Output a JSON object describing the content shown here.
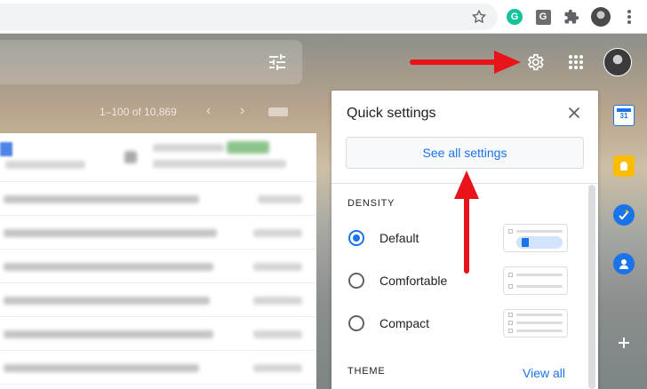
{
  "browser": {
    "icons": [
      "star-icon",
      "grammarly-icon",
      "g-extension-icon",
      "extensions-puzzle-icon",
      "profile-avatar",
      "more-vert-icon"
    ],
    "grammarly_color": "#15c39a"
  },
  "gmail": {
    "pager": "1–100 of 10,869",
    "accent": "#1a73e8"
  },
  "quick_settings": {
    "title": "Quick settings",
    "see_all": "See all settings",
    "density_heading": "DENSITY",
    "options": [
      {
        "label": "Default",
        "checked": true
      },
      {
        "label": "Comfortable",
        "checked": false
      },
      {
        "label": "Compact",
        "checked": false
      }
    ],
    "theme_heading": "THEME",
    "view_all": "View all"
  },
  "side_apps": [
    "calendar-icon",
    "keep-icon",
    "tasks-icon",
    "contacts-icon",
    "add-icon"
  ],
  "annotation_color": "#e8141a"
}
